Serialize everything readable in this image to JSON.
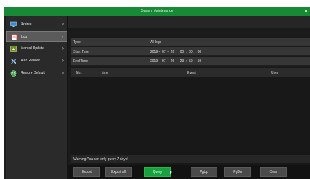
{
  "window": {
    "title": "System Maintenance",
    "close_glyph": "×"
  },
  "sidebar": {
    "items": [
      {
        "label": "System",
        "icon": "monitor-icon"
      },
      {
        "label": "Log",
        "icon": "log-icon"
      },
      {
        "label": "Manual Update",
        "icon": "update-icon"
      },
      {
        "label": "Auto Reboot",
        "icon": "tools-icon"
      },
      {
        "label": "Restore Default",
        "icon": "restore-icon"
      }
    ],
    "active_index": 1
  },
  "filters": {
    "type_label": "Type",
    "type_value": "All logs",
    "start_label": "Start Time",
    "start_value": "2019 -  07  -  26      00  :  00  :  00",
    "end_label": "End Time",
    "end_value": "2019 -  07  -  26      23  :  59  :  59"
  },
  "table": {
    "columns": [
      "No.",
      "time",
      "Event",
      "User"
    ],
    "rows": []
  },
  "warning": "Warning:You can only query 7 days!",
  "buttons": {
    "export": "Export",
    "export_all": "Export all",
    "query": "Query",
    "pgup": "PgUp",
    "pgdn": "PgDn",
    "clear": "Clear"
  },
  "colors": {
    "accent": "#168a35",
    "primary_button": "#17a23d",
    "background": "#141414"
  }
}
